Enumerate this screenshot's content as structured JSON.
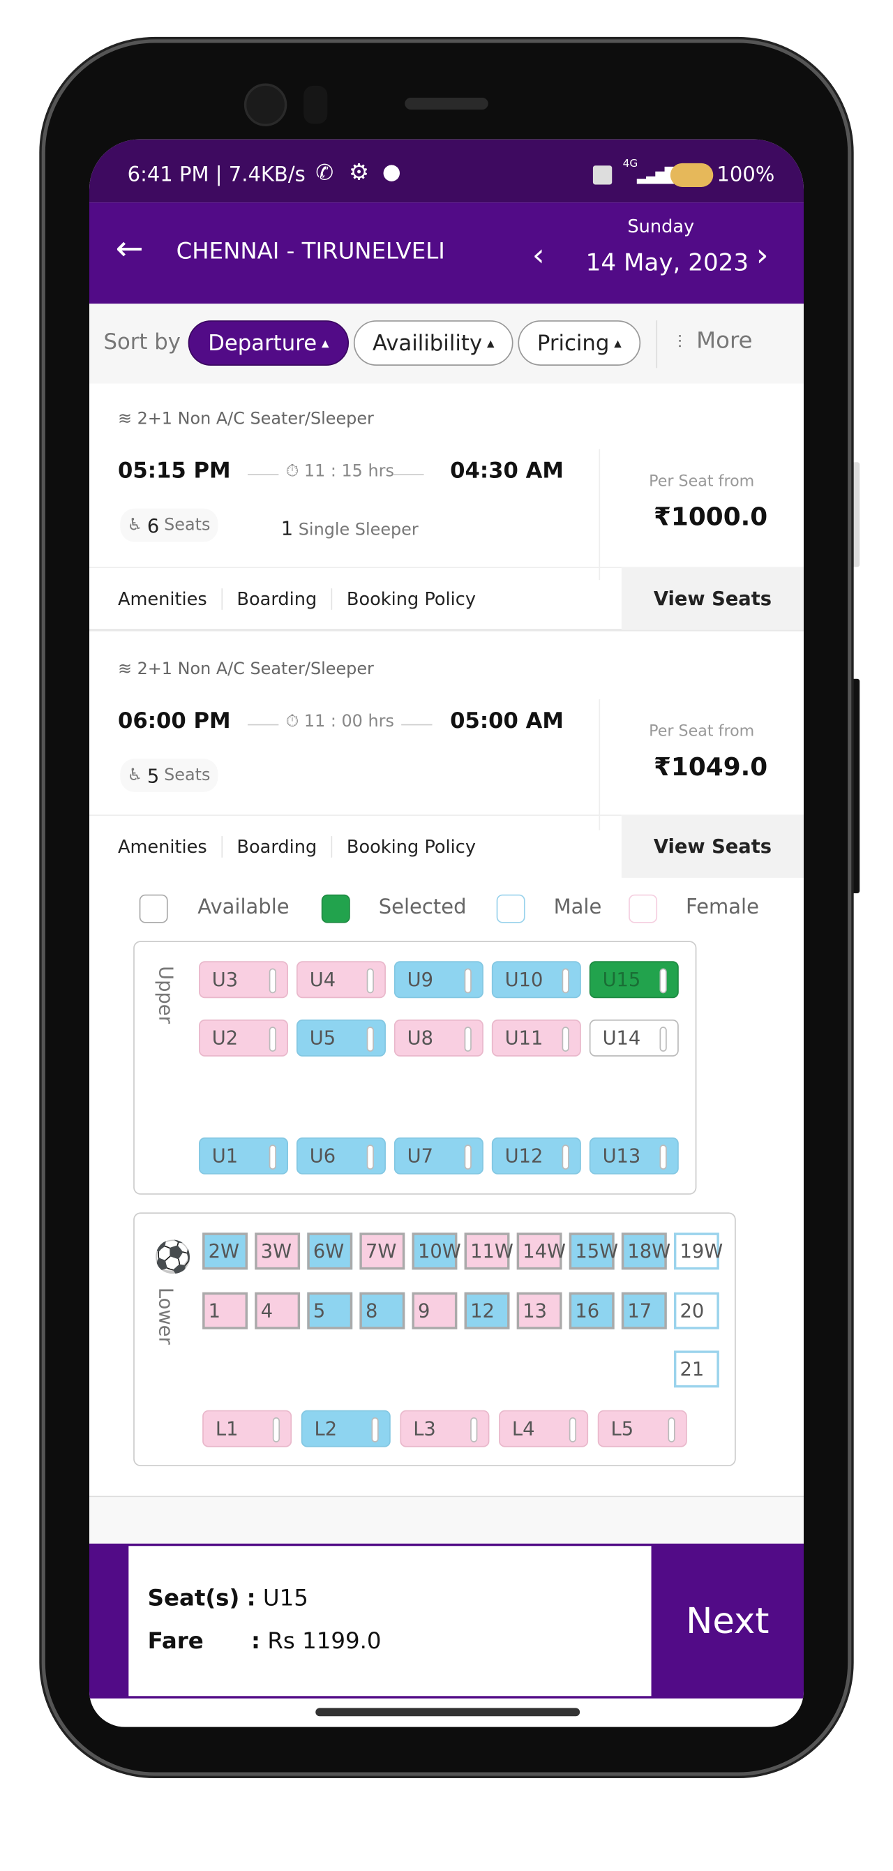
{
  "status_bar": {
    "time": "6:41 PM",
    "speed": "7.4KB/s",
    "network": "4G",
    "battery": "100%",
    "icons": [
      "whatsapp-icon",
      "settings-icon",
      "github-icon",
      "volte-icon",
      "signal-icon",
      "battery-icon"
    ]
  },
  "header": {
    "route": "CHENNAI - TIRUNELVELI",
    "day": "Sunday",
    "date": "14 May, 2023"
  },
  "sort": {
    "label": "Sort by",
    "options": [
      {
        "label": "Departure",
        "active": true
      },
      {
        "label": "Availibility",
        "active": false
      },
      {
        "label": "Pricing",
        "active": false
      }
    ],
    "more": "More"
  },
  "buses": [
    {
      "type": "2+1 Non A/C Seater/Sleeper",
      "departure": "05:15 PM",
      "duration": "11 : 15 hrs",
      "arrival": "04:30 AM",
      "seats_count": "6",
      "seats_label": "Seats",
      "single_count": "1",
      "single_label": "Single Sleeper",
      "per_seat_label": "Per Seat from",
      "price": "₹1000.0",
      "links": [
        "Amenities",
        "Boarding",
        "Booking Policy"
      ],
      "view_seats": "View Seats"
    },
    {
      "type": "2+1 Non A/C Seater/Sleeper",
      "departure": "06:00 PM",
      "duration": "11 : 00 hrs",
      "arrival": "05:00 AM",
      "seats_count": "5",
      "seats_label": "Seats",
      "per_seat_label": "Per Seat from",
      "price": "₹1049.0",
      "links": [
        "Amenities",
        "Boarding",
        "Booking Policy"
      ],
      "view_seats": "View Seats"
    }
  ],
  "legend": {
    "available": "Available",
    "selected": "Selected",
    "male": "Male",
    "female": "Female"
  },
  "colors": {
    "brand": "#520b87",
    "selected": "#22a34d",
    "male": "#8ed4f0",
    "female": "#f9cfe1"
  },
  "upper_deck": {
    "label": "Upper",
    "rows": [
      [
        {
          "id": "U3",
          "s": "female"
        },
        {
          "id": "U4",
          "s": "female"
        },
        {
          "id": "U9",
          "s": "male"
        },
        {
          "id": "U10",
          "s": "male"
        },
        {
          "id": "U15",
          "s": "selected"
        }
      ],
      [
        {
          "id": "U2",
          "s": "female"
        },
        {
          "id": "U5",
          "s": "male"
        },
        {
          "id": "U8",
          "s": "female"
        },
        {
          "id": "U11",
          "s": "female"
        },
        {
          "id": "U14",
          "s": "available"
        }
      ],
      [
        {
          "id": "U1",
          "s": "male"
        },
        {
          "id": "U6",
          "s": "male"
        },
        {
          "id": "U7",
          "s": "male"
        },
        {
          "id": "U12",
          "s": "male"
        },
        {
          "id": "U13",
          "s": "male"
        }
      ]
    ]
  },
  "lower_deck": {
    "label": "Lower",
    "rows": [
      [
        {
          "id": "2W",
          "s": "male"
        },
        {
          "id": "3W",
          "s": "female"
        },
        {
          "id": "6W",
          "s": "male"
        },
        {
          "id": "7W",
          "s": "female"
        },
        {
          "id": "10W",
          "s": "male"
        },
        {
          "id": "11W",
          "s": "female"
        },
        {
          "id": "14W",
          "s": "female"
        },
        {
          "id": "15W",
          "s": "male"
        },
        {
          "id": "18W",
          "s": "male"
        },
        {
          "id": "19W",
          "s": "available"
        }
      ],
      [
        {
          "id": "1",
          "s": "female"
        },
        {
          "id": "4",
          "s": "female"
        },
        {
          "id": "5",
          "s": "male"
        },
        {
          "id": "8",
          "s": "male"
        },
        {
          "id": "9",
          "s": "female"
        },
        {
          "id": "12",
          "s": "male"
        },
        {
          "id": "13",
          "s": "female"
        },
        {
          "id": "16",
          "s": "male"
        },
        {
          "id": "17",
          "s": "male"
        },
        {
          "id": "20",
          "s": "available"
        }
      ],
      [
        {
          "id": "21",
          "s": "available"
        }
      ]
    ],
    "sleepers": [
      {
        "id": "L1",
        "s": "female"
      },
      {
        "id": "L2",
        "s": "male"
      },
      {
        "id": "L3",
        "s": "female"
      },
      {
        "id": "L4",
        "s": "female"
      },
      {
        "id": "L5",
        "s": "female"
      }
    ]
  },
  "summary": {
    "seats_label": "Seat(s)",
    "seats_value": "U15",
    "fare_label": "Fare",
    "fare_value": "Rs 1199.0",
    "next": "Next"
  }
}
